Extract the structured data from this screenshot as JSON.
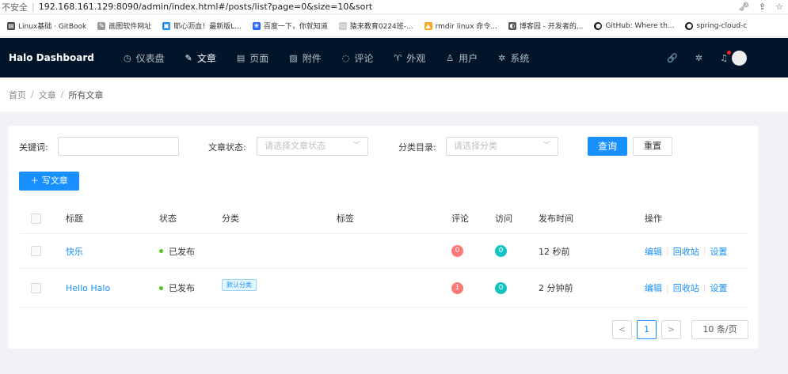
{
  "browser": {
    "security": "不安全",
    "url": "192.168.161.129:8090/admin/index.html#/posts/list?page=0&size=10&sort",
    "bookmarks": [
      {
        "label": "Linux基础 · GitBook",
        "color": "#444",
        "icon": "book-icon"
      },
      {
        "label": "画图软件网址",
        "color": "#999",
        "icon": "pencil-icon"
      },
      {
        "label": "耶心沥血！最新版L...",
        "color": "#1e88e5",
        "icon": "bilibili-icon"
      },
      {
        "label": "百度一下，你就知道",
        "color": "#2962ff",
        "icon": "baidu-icon"
      },
      {
        "label": "猿来教育0224班-...",
        "color": "#ccc",
        "icon": "page-icon"
      },
      {
        "label": "rmdir linux 命令...",
        "color": "#f9a825",
        "icon": "linux-icon"
      },
      {
        "label": "博客园 - 开发者的...",
        "color": "#555",
        "icon": "cnblogs-icon"
      },
      {
        "label": "GitHub: Where th...",
        "color": "#111",
        "icon": "github-icon"
      },
      {
        "label": "spring-cloud-c",
        "color": "#111",
        "icon": "github-icon"
      }
    ]
  },
  "nav": {
    "brand": "Halo  Dashboard",
    "items": [
      {
        "label": "仪表盘",
        "icon": "dashboard-icon",
        "glyph": "◷"
      },
      {
        "label": "文章",
        "icon": "edit-icon",
        "glyph": "✎",
        "active": true
      },
      {
        "label": "页面",
        "icon": "book-icon",
        "glyph": "▤"
      },
      {
        "label": "附件",
        "icon": "picture-icon",
        "glyph": "▨"
      },
      {
        "label": "评论",
        "icon": "comment-icon",
        "glyph": "◌"
      },
      {
        "label": "外观",
        "icon": "shirt-icon",
        "glyph": "♈"
      },
      {
        "label": "用户",
        "icon": "user-icon",
        "glyph": "♙"
      },
      {
        "label": "系统",
        "icon": "gear-icon",
        "glyph": "✲"
      }
    ]
  },
  "breadcrumb": [
    "首页",
    "文章",
    "所有文章"
  ],
  "filter": {
    "keyword_label": "关键词:",
    "keyword_value": "",
    "status_label": "文章状态:",
    "status_placeholder": "请选择文章状态",
    "category_label": "分类目录:",
    "category_placeholder": "请选择分类",
    "query_button": "查询",
    "reset_button": "重置"
  },
  "write_button": "＋ 写文章",
  "table": {
    "headers": [
      "标题",
      "状态",
      "分类",
      "标签",
      "评论",
      "访问",
      "发布时间",
      "操作"
    ],
    "rows": [
      {
        "title": "快乐",
        "status": "已发布",
        "category": "",
        "tags": "",
        "comments": "0",
        "visits": "0",
        "time": "12 秒前",
        "ops": [
          "编辑",
          "回收站",
          "设置"
        ]
      },
      {
        "title": "Hello Halo",
        "status": "已发布",
        "category": "默认分类",
        "tags": "",
        "comments": "1",
        "visits": "0",
        "time": "2 分钟前",
        "ops": [
          "编辑",
          "回收站",
          "设置"
        ]
      }
    ]
  },
  "pagination": {
    "prev": "<",
    "current": "1",
    "next": ">",
    "page_size": "10 条/页"
  },
  "colors": {
    "primary": "#1890ff",
    "nav_bg": "#001529",
    "comment_badge_zero": "#ff7875",
    "comment_badge_one": "#ff7875",
    "visit_badge": "#13c2c2"
  }
}
